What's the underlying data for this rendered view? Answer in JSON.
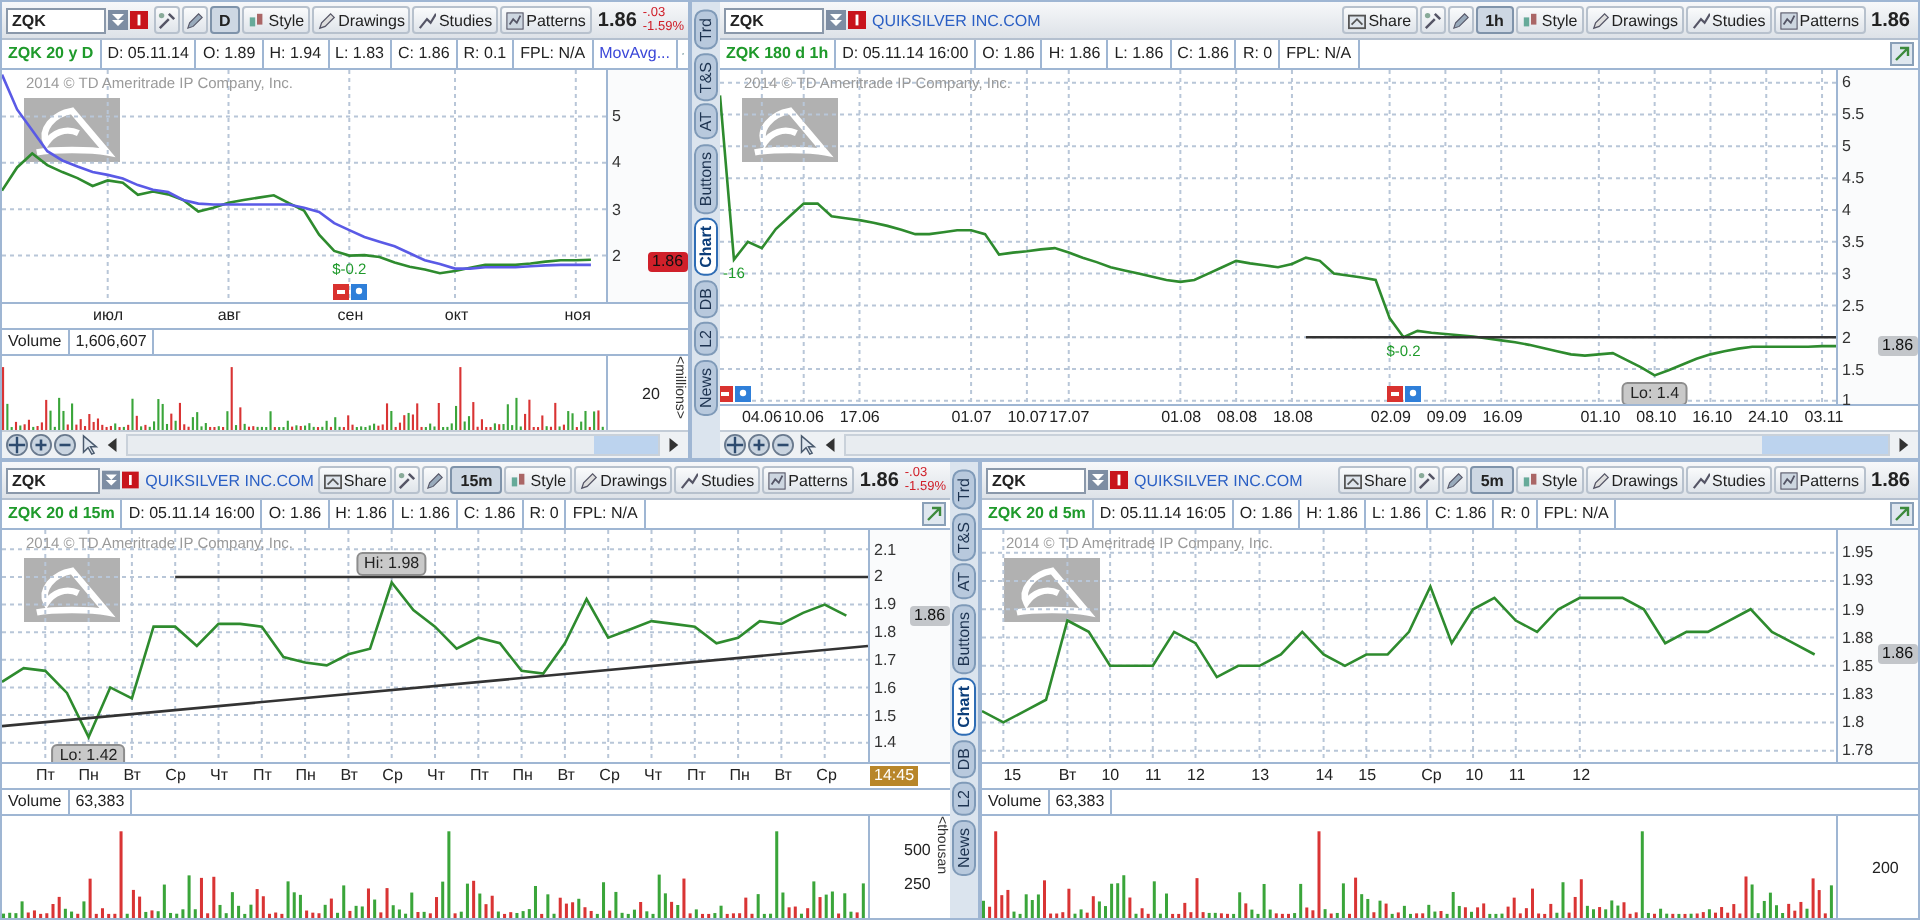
{
  "rows": [
    [
      {
        "symbol": "ZQK",
        "toolbar": {
          "interval": "D",
          "buttons": [
            {
              "label": "Style",
              "kind": "style"
            },
            {
              "label": "Drawings",
              "kind": "drawings"
            },
            {
              "label": "Studies",
              "kind": "studies"
            },
            {
              "label": "Patterns",
              "kind": "patterns"
            }
          ]
        },
        "last": "1.86",
        "change": {
          "abs": "-.03",
          "pct": "-1.59%"
        },
        "info": {
          "title": "ZQK 20 y D",
          "cells": [
            "D: 05.11.14",
            "O: 1.89",
            "H: 1.94",
            "L: 1.83",
            "C: 1.86",
            "R: 0.1",
            "FPL: N/A"
          ],
          "study": "MovAvg..."
        },
        "watermark": "2014 © TD Ameritrade IP Company, Inc.",
        "price_tag": {
          "text": "1.86",
          "color": "#d0202a"
        },
        "scrollbar": true,
        "volume": {
          "label": "Volume",
          "value": "1,606,607",
          "ticks": [
            "20"
          ],
          "unit": "<millions>"
        },
        "chart_data": {
          "type": "line",
          "grid": true,
          "categories": [
            null,
            null,
            null,
            null,
            null,
            null,
            null,
            "июл",
            null,
            null,
            null,
            null,
            null,
            null,
            null,
            "авг",
            null,
            null,
            null,
            null,
            null,
            null,
            null,
            "сен",
            null,
            null,
            null,
            null,
            null,
            null,
            "окт",
            null,
            null,
            null,
            null,
            null,
            null,
            null,
            "ноя",
            null,
            null
          ],
          "ylim": [
            1.0,
            6.0
          ],
          "series": [
            {
              "color": "#2e8b2e",
              "values": [
                3.4,
                3.9,
                4.2,
                3.95,
                3.8,
                3.67,
                3.5,
                3.62,
                3.57,
                3.31,
                3.38,
                3.32,
                3.2,
                2.95,
                3.03,
                3.14,
                3.2,
                3.25,
                3.3,
                3.13,
                2.97,
                2.45,
                2.1,
                2.0,
                2.01,
                1.97,
                1.85,
                1.76,
                1.7,
                1.62,
                1.67,
                1.74,
                1.8,
                1.8,
                1.8,
                1.83,
                1.87,
                1.9,
                1.9,
                1.91,
                null
              ]
            },
            {
              "color": "#5a5ae6",
              "values": [
                5.9,
                5.15,
                4.7,
                4.25,
                4.05,
                3.92,
                3.8,
                3.74,
                3.66,
                3.52,
                3.42,
                3.37,
                3.2,
                3.12,
                3.1,
                3.1,
                3.1,
                3.1,
                3.1,
                3.1,
                3.03,
                2.94,
                2.7,
                2.55,
                2.4,
                2.3,
                2.2,
                2.05,
                1.9,
                1.82,
                1.72,
                1.72,
                1.75,
                1.75,
                1.75,
                1.77,
                1.79,
                1.8,
                1.8,
                1.8,
                null
              ]
            }
          ],
          "yticks": [
            2,
            3,
            4,
            5
          ],
          "annotations": [
            {
              "text": "$-0.2",
              "y": 2.0
            }
          ]
        }
      },
      {
        "symbol": "ZQK",
        "company": "QUIKSILVER INC.COM",
        "toolbar": {
          "share": "Share",
          "interval": "1h",
          "buttons": [
            {
              "label": "Style",
              "kind": "style"
            },
            {
              "label": "Drawings",
              "kind": "drawings"
            },
            {
              "label": "Studies",
              "kind": "studies"
            },
            {
              "label": "Patterns",
              "kind": "patterns"
            }
          ]
        },
        "last": "1.86",
        "info": {
          "title": "ZQK 180 d 1h",
          "cells": [
            "D: 05.11.14 16:00",
            "O: 1.86",
            "H: 1.86",
            "L: 1.86",
            "C: 1.86",
            "R: 0",
            "FPL: N/A"
          ]
        },
        "side_tabs": [
          {
            "label": "Trd",
            "selected": false
          },
          {
            "label": "T&S",
            "selected": false
          },
          {
            "label": "AT",
            "selected": false
          },
          {
            "label": "Buttons",
            "selected": false
          },
          {
            "label": "Chart",
            "selected": true
          },
          {
            "label": "DB",
            "selected": false
          },
          {
            "label": "L2",
            "selected": false
          },
          {
            "label": "News",
            "selected": false
          }
        ],
        "watermark": "2014 © TD Ameritrade IP Company, Inc.",
        "price_tag": {
          "text": "1.86",
          "color": "#c3c6ca"
        },
        "scrollbar": true,
        "chart_data": {
          "type": "line",
          "grid": true,
          "categories": [
            null,
            null,
            null,
            "04.06",
            null,
            null,
            "10.06",
            null,
            null,
            null,
            "17.06",
            null,
            null,
            null,
            null,
            null,
            null,
            null,
            "01.07",
            null,
            null,
            null,
            "10.07",
            null,
            null,
            "17.07",
            null,
            null,
            null,
            null,
            null,
            null,
            null,
            "01.08",
            null,
            null,
            null,
            "08.08",
            null,
            null,
            null,
            "18.08",
            null,
            null,
            null,
            null,
            null,
            null,
            "02.09",
            null,
            null,
            null,
            "09.09",
            null,
            null,
            null,
            "16.09",
            null,
            null,
            null,
            null,
            null,
            null,
            "01.10",
            null,
            null,
            null,
            "08.10",
            null,
            null,
            null,
            "16.10",
            null,
            null,
            null,
            "24.10",
            null,
            null,
            null,
            "03.11",
            null
          ],
          "ylim": [
            0.95,
            6.2
          ],
          "series": [
            {
              "color": "#2e8b2e",
              "values": [
                5.8,
                3.22,
                3.5,
                3.4,
                3.7,
                3.9,
                4.1,
                4.1,
                3.9,
                3.87,
                3.84,
                3.8,
                3.75,
                3.69,
                3.62,
                3.62,
                3.65,
                3.68,
                3.68,
                3.62,
                3.3,
                3.33,
                3.35,
                3.38,
                3.4,
                3.33,
                3.25,
                3.18,
                3.1,
                3.05,
                3.0,
                2.95,
                2.9,
                2.87,
                2.9,
                3.0,
                3.1,
                3.2,
                3.16,
                3.13,
                3.1,
                3.15,
                3.25,
                3.2,
                3.0,
                2.97,
                2.94,
                2.9,
                2.3,
                2.0,
                2.1,
                2.07,
                2.05,
                2.03,
                2.01,
                1.98,
                1.95,
                1.92,
                1.88,
                1.83,
                1.78,
                1.73,
                1.71,
                1.73,
                1.75,
                1.64,
                1.53,
                1.4,
                1.48,
                1.57,
                1.66,
                1.73,
                1.78,
                1.82,
                1.85,
                1.85,
                1.85,
                1.85,
                1.85,
                1.86,
                1.86
              ]
            },
            {
              "color": "#333333",
              "values": [
                null,
                null,
                null,
                null,
                null,
                null,
                null,
                null,
                null,
                null,
                null,
                null,
                null,
                null,
                null,
                null,
                null,
                null,
                null,
                null,
                null,
                null,
                null,
                null,
                null,
                null,
                null,
                null,
                null,
                null,
                null,
                null,
                null,
                null,
                null,
                null,
                null,
                null,
                null,
                null,
                null,
                null,
                2.0,
                null,
                null,
                null,
                null,
                null,
                null,
                null,
                null,
                null,
                null,
                null,
                null,
                null,
                null,
                null,
                null,
                null,
                null,
                null,
                null,
                null,
                null,
                null,
                null,
                null,
                null,
                null,
                null,
                null,
                null,
                null,
                null,
                null,
                null,
                null,
                null,
                null,
                2.0
              ]
            }
          ],
          "yticks": [
            1,
            1.5,
            2,
            2.5,
            3,
            3.5,
            4,
            4.5,
            5,
            5.5,
            6
          ],
          "annotations": [
            {
              "text": "-16",
              "y": 3.22
            },
            {
              "text": "$-0.2",
              "y": 2.0
            },
            {
              "text": "Lo: 1.4",
              "y": 1.4
            }
          ]
        }
      }
    ],
    [
      {
        "symbol": "ZQK",
        "company": "QUIKSILVER INC.COM",
        "toolbar": {
          "share": "Share",
          "interval": "15m",
          "buttons": [
            {
              "label": "Style",
              "kind": "style"
            },
            {
              "label": "Drawings",
              "kind": "drawings"
            },
            {
              "label": "Studies",
              "kind": "studies"
            },
            {
              "label": "Patterns",
              "kind": "patterns"
            }
          ]
        },
        "last": "1.86",
        "change": {
          "abs": "-.03",
          "pct": "-1.59%"
        },
        "info": {
          "title": "ZQK 20 d 15m",
          "cells": [
            "D: 05.11.14 16:00",
            "O: 1.86",
            "H: 1.86",
            "L: 1.86",
            "C: 1.86",
            "R: 0",
            "FPL: N/A"
          ]
        },
        "side_tabs": [
          {
            "label": "Trd",
            "selected": false
          },
          {
            "label": "T&S",
            "selected": false
          },
          {
            "label": "AT",
            "selected": false
          },
          {
            "label": "Buttons",
            "selected": false
          },
          {
            "label": "Chart",
            "selected": true
          },
          {
            "label": "DB",
            "selected": false
          },
          {
            "label": "L2",
            "selected": false
          },
          {
            "label": "News",
            "selected": false
          }
        ],
        "watermark": "2014 © TD Ameritrade IP Company, Inc.",
        "price_tag": {
          "text": "1.86",
          "color": "#c3c6ca"
        },
        "scrollbar": false,
        "time_tag": "14:45",
        "volume": {
          "label": "Volume",
          "value": "63,383",
          "ticks": [
            "500",
            "250"
          ],
          "unit": "<thousan"
        },
        "chart_data": {
          "type": "line",
          "grid": true,
          "categories": [
            null,
            null,
            "Пт",
            null,
            "Пн",
            null,
            "Вт",
            null,
            "Ср",
            null,
            "Чт",
            null,
            "Пт",
            null,
            "Пн",
            null,
            "Вт",
            null,
            "Ср",
            null,
            "Чт",
            null,
            "Пт",
            null,
            "Пн",
            null,
            "Вт",
            null,
            "Ср",
            null,
            "Чт",
            null,
            "Пт",
            null,
            "Пн",
            null,
            "Вт",
            null,
            "Ср",
            null,
            null
          ],
          "ylim": [
            1.33,
            2.17
          ],
          "series": [
            {
              "color": "#2e8b2e",
              "values": [
                1.62,
                1.67,
                1.66,
                1.58,
                1.42,
                1.6,
                1.56,
                1.82,
                1.82,
                1.75,
                1.83,
                1.83,
                1.82,
                1.71,
                1.69,
                1.68,
                1.72,
                1.74,
                1.98,
                1.88,
                1.82,
                1.74,
                1.78,
                1.76,
                1.66,
                1.65,
                1.76,
                1.92,
                1.78,
                1.81,
                1.84,
                1.83,
                1.82,
                1.76,
                1.78,
                1.84,
                1.83,
                1.87,
                1.9,
                1.86,
                null
              ]
            },
            {
              "color": "#333333",
              "values": [
                null,
                null,
                null,
                null,
                null,
                null,
                null,
                null,
                2.0,
                null,
                null,
                null,
                null,
                null,
                null,
                null,
                null,
                null,
                null,
                null,
                null,
                null,
                null,
                null,
                null,
                null,
                null,
                null,
                null,
                null,
                null,
                null,
                null,
                null,
                null,
                null,
                null,
                null,
                null,
                null,
                2.0
              ]
            },
            {
              "color": "#333333",
              "values": [
                1.46,
                null,
                null,
                null,
                null,
                null,
                null,
                null,
                null,
                null,
                null,
                null,
                null,
                null,
                null,
                null,
                null,
                null,
                null,
                null,
                null,
                null,
                null,
                null,
                null,
                null,
                null,
                null,
                null,
                null,
                null,
                null,
                null,
                null,
                null,
                null,
                null,
                null,
                null,
                null,
                1.75
              ]
            }
          ],
          "yticks": [
            1.4,
            1.5,
            1.6,
            1.7,
            1.8,
            1.9,
            2,
            2.1
          ],
          "annotations": [
            {
              "text": "Hi: 1.98",
              "y": 1.98
            },
            {
              "text": "Lo: 1.42",
              "y": 1.42
            }
          ]
        }
      },
      {
        "symbol": "ZQK",
        "company": "QUIKSILVER INC.COM",
        "toolbar": {
          "share": "Share",
          "interval": "5m",
          "buttons": [
            {
              "label": "Style",
              "kind": "style"
            },
            {
              "label": "Drawings",
              "kind": "drawings"
            },
            {
              "label": "Studies",
              "kind": "studies"
            },
            {
              "label": "Patterns",
              "kind": "patterns"
            }
          ]
        },
        "last": "1.86",
        "info": {
          "title": "ZQK 20 d 5m",
          "cells": [
            "D: 05.11.14 16:05",
            "O: 1.86",
            "H: 1.86",
            "L: 1.86",
            "C: 1.86",
            "R: 0",
            "FPL: N/A"
          ]
        },
        "watermark": "2014 © TD Ameritrade IP Company, Inc.",
        "price_tag": {
          "text": "1.86",
          "color": "#c3c6ca"
        },
        "scrollbar": false,
        "volume": {
          "label": "Volume",
          "value": "63,383",
          "ticks": [
            "200"
          ]
        },
        "chart_data": {
          "type": "line",
          "grid": true,
          "categories": [
            null,
            "15",
            null,
            null,
            "Вт",
            null,
            "10",
            null,
            "11",
            null,
            "12",
            null,
            null,
            "13",
            null,
            null,
            "14",
            null,
            "15",
            null,
            null,
            "Ср",
            null,
            "10",
            null,
            "11",
            null,
            null,
            "12",
            null,
            null,
            null,
            null,
            null,
            null,
            null,
            null,
            null,
            null,
            null,
            null
          ],
          "ylim": [
            1.765,
            1.97
          ],
          "series": [
            {
              "color": "#2e8b2e",
              "values": [
                1.81,
                1.8,
                1.81,
                1.82,
                1.89,
                1.88,
                1.85,
                1.85,
                1.85,
                1.88,
                1.87,
                1.84,
                1.85,
                1.85,
                1.86,
                1.88,
                1.86,
                1.85,
                1.86,
                1.86,
                1.88,
                1.92,
                1.87,
                1.9,
                1.91,
                1.89,
                1.88,
                1.9,
                1.91,
                1.91,
                1.91,
                1.9,
                1.87,
                1.88,
                1.88,
                1.89,
                1.9,
                1.88,
                1.87,
                1.86,
                null
              ]
            }
          ],
          "yticks": [
            {
              "value": 1.775,
              "label": "1.78"
            },
            {
              "value": 1.8,
              "label": "1.8"
            },
            {
              "value": 1.825,
              "label": "1.83"
            },
            {
              "value": 1.85,
              "label": "1.85"
            },
            {
              "value": 1.875,
              "label": "1.88"
            },
            {
              "value": 1.9,
              "label": "1.9"
            },
            {
              "value": 1.925,
              "label": "1.93"
            },
            {
              "value": 1.95,
              "label": "1.95"
            }
          ]
        }
      }
    ]
  ]
}
